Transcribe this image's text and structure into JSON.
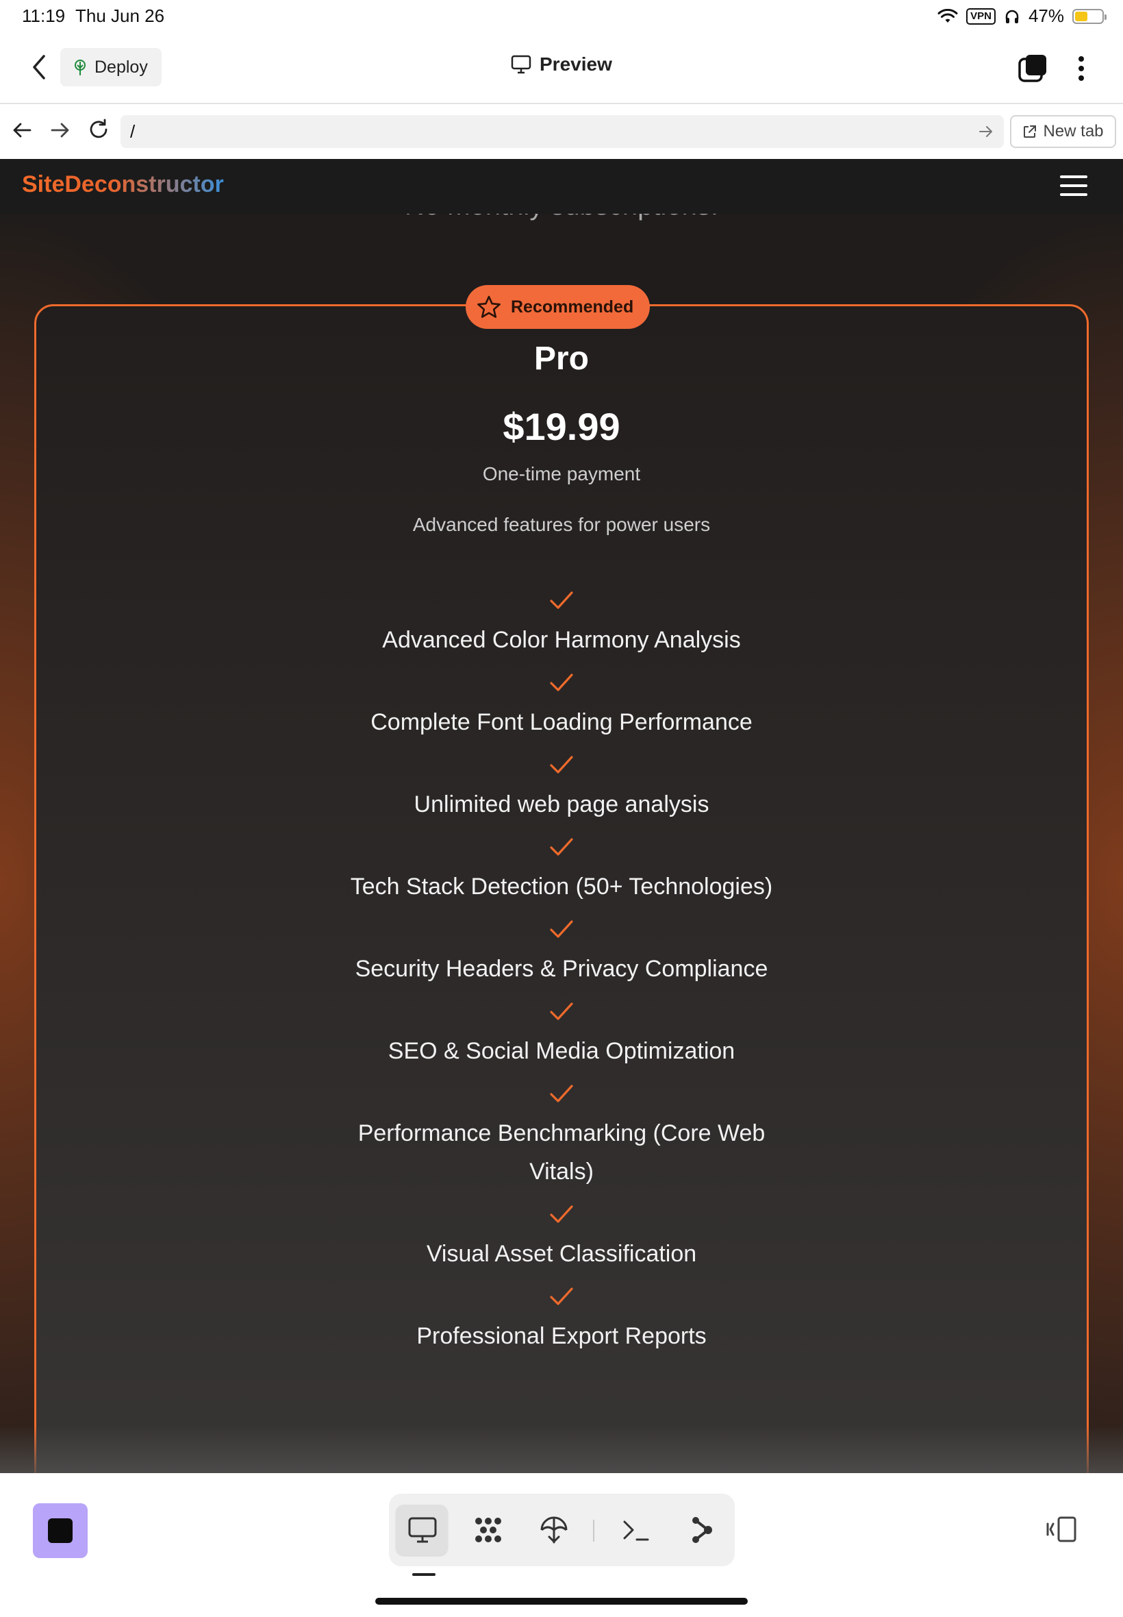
{
  "status_bar": {
    "time": "11:19",
    "date": "Thu Jun 26",
    "vpn": "VPN",
    "battery_text": "47%",
    "battery_level": 0.47
  },
  "toolbar": {
    "deploy_label": "Deploy",
    "title": "Preview"
  },
  "urlbar": {
    "value": "/",
    "new_tab_label": "New tab"
  },
  "site": {
    "brand": "SiteDeconstructor",
    "partial_heading": "No monthly subscriptions!"
  },
  "plan": {
    "badge": "Recommended",
    "name": "Pro",
    "price": "$19.99",
    "payment": "One-time payment",
    "description": "Advanced features for power users",
    "features": [
      "Advanced Color Harmony Analysis",
      "Complete Font Loading Performance",
      "Unlimited web page analysis",
      "Tech Stack Detection (50+ Technologies)",
      "Security Headers & Privacy Compliance",
      "SEO & Social Media Optimization",
      "Performance Benchmarking (Core Web Vitals)",
      "Visual Asset Classification",
      "Professional Export Reports"
    ]
  },
  "dock": {
    "tabs": [
      "preview-tab",
      "apps-tab",
      "deploy-tab",
      "console-tab",
      "git-tab"
    ],
    "active_tab": "preview-tab"
  },
  "colors": {
    "accent": "#ee6a2c",
    "badge": "#f26a3a",
    "brand_start": "#f26a2a",
    "brand_end": "#3a8fd8",
    "stop_button": "#b8a4f8"
  }
}
